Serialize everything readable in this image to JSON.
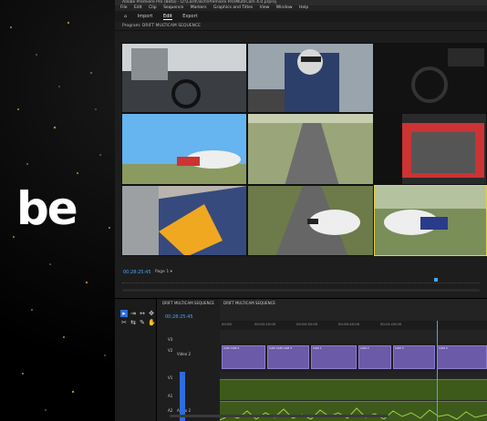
{
  "brand": {
    "text": "be"
  },
  "window": {
    "title": "Adobe Premiere Pro (Beta) - D:\\Card\\Tech\\Premiere Pro\\MultiCam 4.0.prproj",
    "menu": [
      "File",
      "Edit",
      "Clip",
      "Sequence",
      "Markers",
      "Graphics and Titles",
      "View",
      "Window",
      "Help"
    ],
    "nav": {
      "home": "⌂",
      "tabs": [
        "Import",
        "Edit",
        "Export"
      ],
      "active": "Edit"
    },
    "monitor_header": "Program: DRIFT MULTICAM SEQUENCE",
    "timecode": "00:28:25:45",
    "fit": "Page 1",
    "fit_arrow": "▾",
    "colors": {
      "accent": "#4da3ff",
      "clip": "#6b5aa8",
      "audio": "#3d5a1a",
      "select": "#e6d24a"
    }
  },
  "project_panel": {
    "tab": "DRIFT MULTICAM SEQUENCE"
  },
  "timeline": {
    "tab": "DRIFT MULTICAM SEQUENCE",
    "timecode": "00:28:25:45",
    "ruler": [
      "00:00",
      "00:00:15:00",
      "00:00:30:00",
      "00:00:45:00",
      "00:01:00:00"
    ],
    "tracks": [
      {
        "id": "V3",
        "name": ""
      },
      {
        "id": "V2",
        "name": "Video 2"
      },
      {
        "id": "V1",
        "name": ""
      },
      {
        "id": "A1",
        "name": ""
      },
      {
        "id": "A2",
        "name": "Audio 2"
      }
    ],
    "clips": [
      {
        "label": "CAM CAM 4",
        "color": "#6b5aa8"
      },
      {
        "label": "CAM CAM CAM 3",
        "color": "#6b5aa8"
      },
      {
        "label": "CAM 1",
        "color": "#6b5aa8"
      },
      {
        "label": "CAM 2",
        "color": "#6b5aa8"
      },
      {
        "label": "CAM 3",
        "color": "#6b5aa8"
      },
      {
        "label": "CAM 4",
        "color": "#6b5aa8"
      }
    ]
  }
}
